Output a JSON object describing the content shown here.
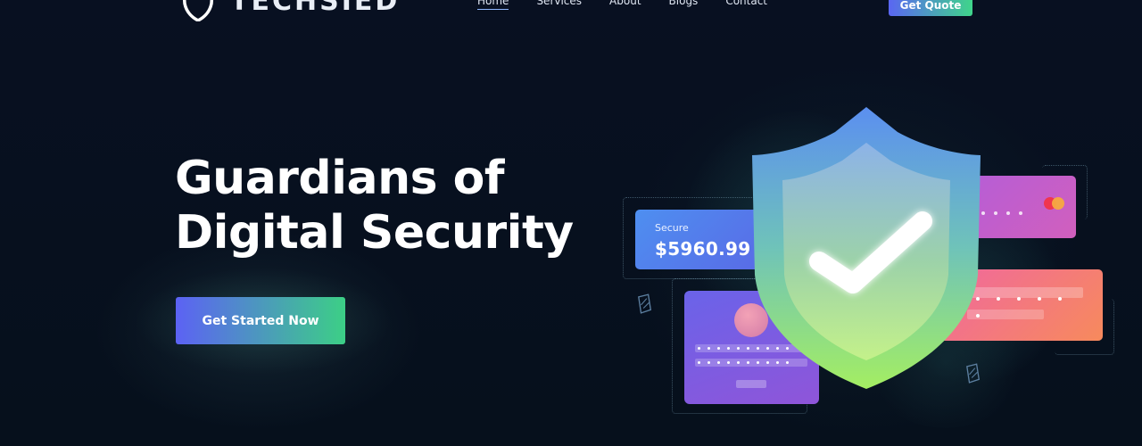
{
  "brand": {
    "name": "TECHSIED"
  },
  "nav": {
    "items": [
      {
        "label": "Home",
        "active": true
      },
      {
        "label": "Services",
        "active": false
      },
      {
        "label": "About",
        "active": false
      },
      {
        "label": "Blogs",
        "active": false
      },
      {
        "label": "Contact",
        "active": false
      }
    ],
    "quote_label": "Get Quote"
  },
  "hero": {
    "title_line1": "Guardians of",
    "title_line2": "Digital Security",
    "cta_label": "Get Started Now"
  },
  "illustration": {
    "card_label": "Secure",
    "card_amount": "$5960.99",
    "icons": [
      "shield-check-icon",
      "mastercard-icon",
      "avatar"
    ]
  },
  "colors": {
    "background": "#070f1d",
    "accent_start": "#5c62f4",
    "accent_end": "#3ccf86",
    "logo_red": "#e63946"
  }
}
